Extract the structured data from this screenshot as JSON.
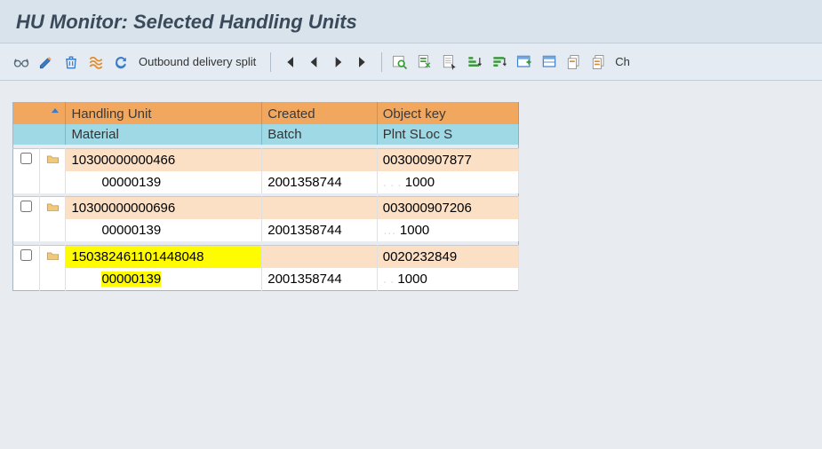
{
  "title": "HU Monitor: Selected Handling Units",
  "toolbar": {
    "outbound_split": "Outbound delivery split",
    "ch": "Ch"
  },
  "headers": {
    "handling_unit": "Handling Unit",
    "created": "Created",
    "object_key": "Object key",
    "material": "Material",
    "batch": "Batch",
    "plnt_sloc": "Plnt SLoc S"
  },
  "rows": [
    {
      "hu": "10300000000466",
      "created": "",
      "object_key": "003000907877",
      "material": "00000139",
      "batch": "2001358744",
      "plnt_sloc": "1000",
      "highlight": false
    },
    {
      "hu": "10300000000696",
      "created": "",
      "object_key": "003000907206",
      "material": "00000139",
      "batch": "2001358744",
      "plnt_sloc": "1000",
      "highlight": false
    },
    {
      "hu": "150382461101448048",
      "created": "",
      "object_key": "0020232849",
      "material": "00000139",
      "batch": "2001358744",
      "plnt_sloc": "1000",
      "highlight": true
    }
  ]
}
